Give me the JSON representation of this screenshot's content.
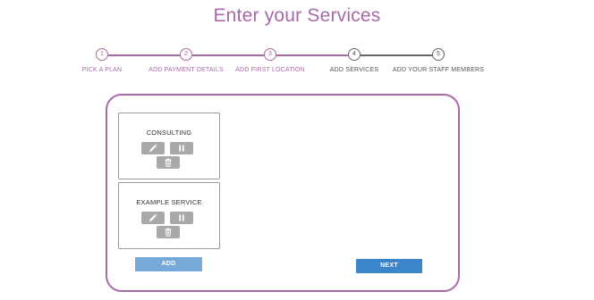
{
  "page": {
    "title": "Enter your Services"
  },
  "colors": {
    "accent": "#a86aa6",
    "inactive": "#666666",
    "icon_button": "#a9a9a9",
    "add_button": "#76a8d8",
    "next_button": "#3b85cb"
  },
  "stepper": {
    "current_step": 4,
    "steps": [
      {
        "number": "1",
        "label": "PICK A PLAN",
        "state": "completed"
      },
      {
        "number": "2",
        "label": "ADD PAYMENT DETAILS",
        "state": "completed"
      },
      {
        "number": "3",
        "label": "ADD FIRST LOCATION",
        "state": "completed"
      },
      {
        "number": "4",
        "label": "ADD SERVICES",
        "state": "current"
      },
      {
        "number": "5",
        "label": "ADD YOUR STAFF MEMBERS",
        "state": "future"
      }
    ]
  },
  "services": [
    {
      "name": "CONSULTING",
      "actions": [
        {
          "icon": "pencil-icon",
          "action": "edit"
        },
        {
          "icon": "pause-icon",
          "action": "pause"
        },
        {
          "icon": "trash-icon",
          "action": "delete"
        }
      ]
    },
    {
      "name": "EXAMPLE SERVICE",
      "actions": [
        {
          "icon": "pencil-icon",
          "action": "edit"
        },
        {
          "icon": "pause-icon",
          "action": "pause"
        },
        {
          "icon": "trash-icon",
          "action": "delete"
        }
      ]
    }
  ],
  "buttons": {
    "add_label": "ADD",
    "next_label": "NEXT"
  }
}
